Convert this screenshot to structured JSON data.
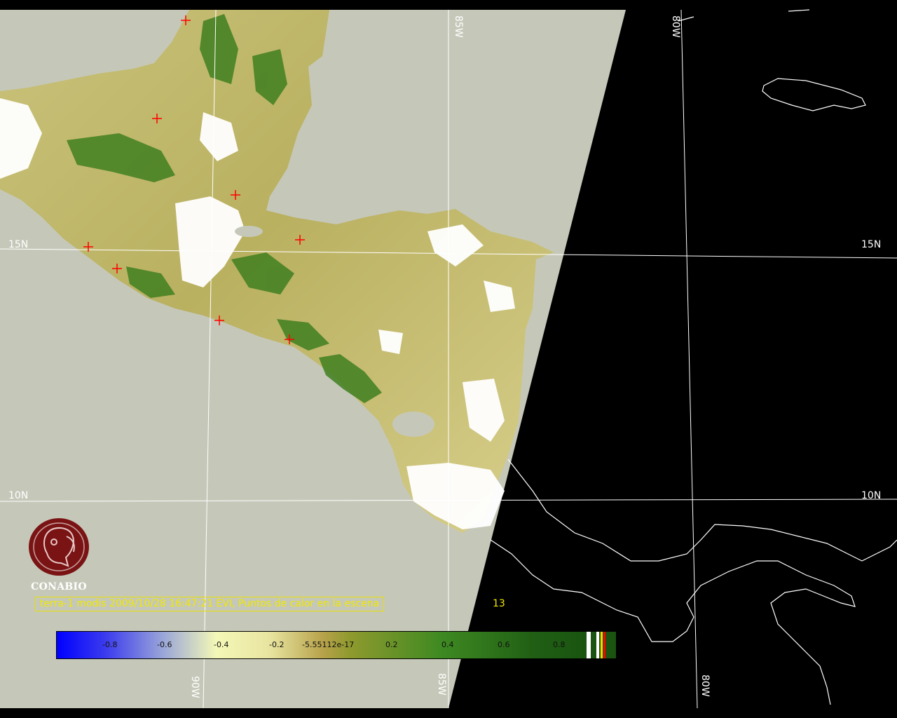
{
  "grid": {
    "lon_labels_top": [
      "85W",
      "80W"
    ],
    "lon_labels_bottom": [
      "90W",
      "85W",
      "80W"
    ],
    "lat_labels_left": [
      "15N",
      "10N"
    ],
    "lat_labels_right": [
      "15N",
      "10N"
    ]
  },
  "caption": {
    "text": "terra-1 modis 2009/10/28 16:47:21 EVI, Puntos de calor en la escena",
    "hotspot_count": "13"
  },
  "colorbar": {
    "ticks": [
      "-0.8",
      "-0.6",
      "-0.4",
      "-0.2",
      "-5.55112e-17",
      "0.2",
      "0.4",
      "0.6",
      "0.8"
    ]
  },
  "logo": {
    "name": "CONABIO"
  },
  "colors": {
    "no_data": "#c5c8b9",
    "night": "#000000",
    "grid": "#ffffff",
    "hotspot": "#ff0000",
    "caption": "#f0e800",
    "logo": "#7a1414"
  }
}
